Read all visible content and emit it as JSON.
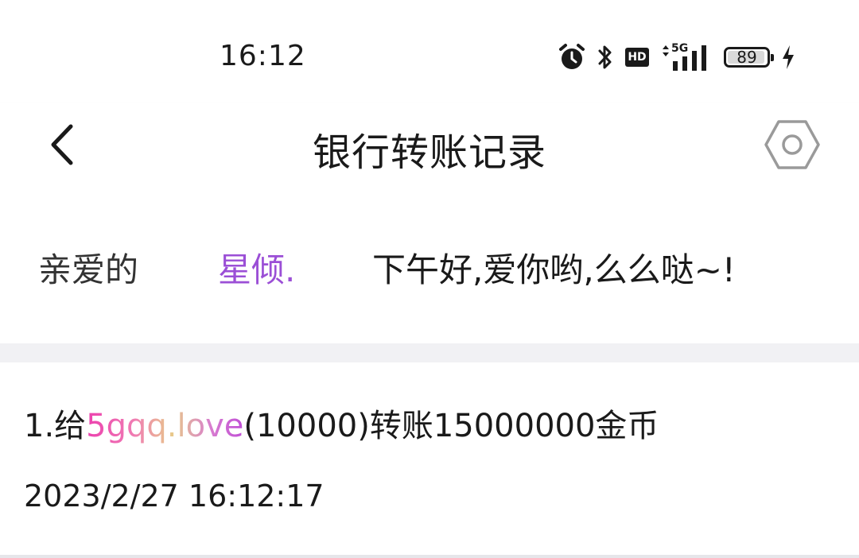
{
  "status_bar": {
    "time": "16:12",
    "icons": [
      "alarm-icon",
      "bluetooth-icon",
      "hd-icon",
      "5g-signal-icon",
      "battery-icon",
      "charging-icon"
    ],
    "hd_label": "HD",
    "network_label": "5G",
    "battery_level": "89"
  },
  "nav": {
    "title": "银行转账记录",
    "back_icon": "chevron-left-icon",
    "settings_icon": "hexagon-settings-icon"
  },
  "greeting": {
    "salutation": "亲爱的",
    "name": "星倾.",
    "message": "下午好,爱你哟,么么哒~!"
  },
  "records": [
    {
      "prefix": "1.给",
      "user": "5gqq.love",
      "suffix": "(10000)转账15000000金币",
      "time": "2023/2/27 16:12:17"
    }
  ],
  "colors": {
    "accent": "#9b4fd6",
    "divider": "#f1f1f4",
    "text": "#1a1a1a"
  }
}
